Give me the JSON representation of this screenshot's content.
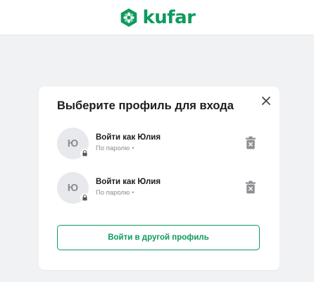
{
  "brand": {
    "name": "kufar",
    "color": "#0f9a5f",
    "logo_icon": "kufar-hexagon-logo-icon"
  },
  "dialog": {
    "title": "Выберите профиль для входа",
    "close_icon": "close-icon",
    "profiles": [
      {
        "initial": "Ю",
        "label": "Войти как Юлия",
        "method": "По паролю",
        "method_marker": "•",
        "badge_icon": "lock-icon",
        "action_icon": "delete-profile-icon"
      },
      {
        "initial": "Ю",
        "label": "Войти как Юлия",
        "method": "По паролю",
        "method_marker": "•",
        "badge_icon": "lock-icon",
        "action_icon": "delete-profile-icon"
      }
    ],
    "other_profile_label": "Войти в другой профиль"
  },
  "colors": {
    "page_background": "#f1f2f4",
    "accent": "#0f9a5f",
    "avatar_background": "#e8e9ec",
    "method_marker": "#e57a7a"
  }
}
